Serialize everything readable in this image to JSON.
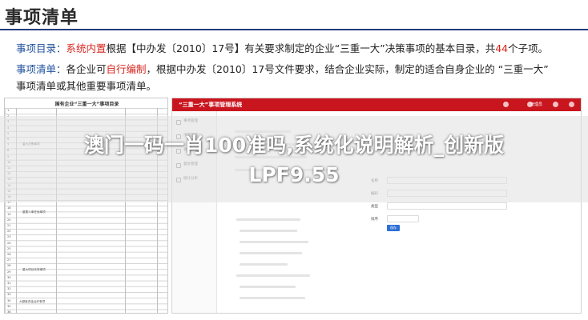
{
  "slide": {
    "title": "事项清单",
    "line1": {
      "label": "事项目录：",
      "highlight": "系统内置",
      "text_a": "根据【中办发〔2010〕17号】有关要求制定的企业“三重一大”决策事项的基本目录，共",
      "count": "44",
      "text_b": "个子项。"
    },
    "line2": {
      "label": "事项清单：",
      "text_a": "各企业可",
      "highlight": "自行编制",
      "text_b": "，根据中办发〔2010〕17号文件要求，结合企业实际，制定的适合自身企业的 “三重一大”"
    },
    "line3": "事项清单或其他重要事项清单。"
  },
  "doc_table": {
    "title": "国有企业“三重一大”事项目录",
    "row_numbers": [
      "1",
      "2",
      "3",
      "4",
      "5",
      "6",
      "7",
      "8",
      "9",
      "10",
      "11",
      "12",
      "13",
      "14",
      "15",
      "16",
      "17",
      "18",
      "19",
      "20",
      "21",
      "22",
      "23",
      "24",
      "25",
      "26",
      "27",
      "28",
      "29",
      "30",
      "31",
      "32",
      "33",
      "34",
      "35",
      "36"
    ],
    "section_labels": [
      "重大决策事项",
      "重要人事任免事项",
      "重大项目安排事项",
      "大额度资金运作事项"
    ]
  },
  "system": {
    "title": "“三重一大”事项管理系统",
    "user": "管理员",
    "menu": [
      "事项管理",
      "决策管理",
      "会议管理",
      "督办管理",
      "统计分析"
    ],
    "form_labels": [
      "名称",
      "编码",
      "类型",
      "排序"
    ],
    "button": "保存"
  },
  "overlay": {
    "headline_1": "澳门一码一肖100准吗,系统化说明解析_创新版",
    "headline_2": "LPF9.55"
  },
  "colors": {
    "title_rule": "#1f3f7a",
    "label_blue": "#1e4f9c",
    "accent_red": "#d8231c",
    "system_header": "#c9151e",
    "button_blue": "#2d6fd6"
  }
}
